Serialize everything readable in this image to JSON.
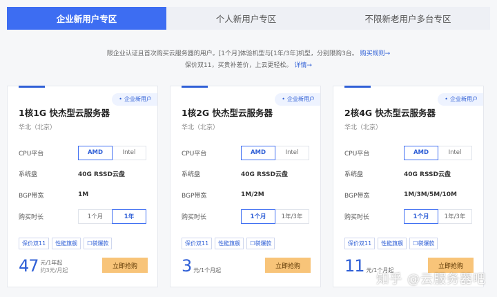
{
  "tabs": [
    {
      "label": "企业新用户专区",
      "active": true
    },
    {
      "label": "个人新用户专区",
      "active": false
    },
    {
      "label": "不限新老用户多台专区",
      "active": false
    }
  ],
  "intro": {
    "line1": "限企业认证且首次购买云服务器的用户。[1个月]体验机型与[1年/3年]机型，分别限购3台。",
    "line1_link": "购买规则",
    "line2": "保价双11，买贵补差价，上云更轻松。",
    "line2_link": "详情"
  },
  "cards": [
    {
      "badge": "企业新用户",
      "title": "1核1G 快杰型云服务器",
      "region": "华北（北京）",
      "cpu_label": "CPU平台",
      "cpu_options": [
        "AMD",
        "Intel"
      ],
      "disk_label": "系统盘",
      "disk_value": "40G RSSD云盘",
      "bw_label": "BGP带宽",
      "bw_value": "1M",
      "dur_label": "购买时长",
      "dur_options": [
        "1个月",
        "1年"
      ],
      "tags": [
        "保价双11",
        "性能旗舰",
        "☐袋爆款"
      ],
      "price_num": "47",
      "price_unit": "元/1年起",
      "price_sub": "约3元/月起",
      "buy_label": "立即抢购"
    },
    {
      "badge": "企业新用户",
      "title": "1核2G 快杰型云服务器",
      "region": "华北（北京）",
      "cpu_label": "CPU平台",
      "cpu_options": [
        "AMD",
        "Intel"
      ],
      "disk_label": "系统盘",
      "disk_value": "40G RSSD云盘",
      "bw_label": "BGP带宽",
      "bw_value": "1M/2M",
      "dur_label": "购买时长",
      "dur_options": [
        "1个月",
        "1年/3年"
      ],
      "tags": [
        "保价双11",
        "性能旗舰",
        "☐袋爆款"
      ],
      "price_num": "3",
      "price_unit": "元/1个月起",
      "price_sub": "",
      "buy_label": "立即抢购"
    },
    {
      "badge": "企业新用户",
      "title": "2核4G 快杰型云服务器",
      "region": "华北（北京）",
      "cpu_label": "CPU平台",
      "cpu_options": [
        "AMD",
        "Intel"
      ],
      "disk_label": "系统盘",
      "disk_value": "40G RSSD云盘",
      "bw_label": "BGP带宽",
      "bw_value": "1M/3M/5M/10M",
      "dur_label": "购买时长",
      "dur_options": [
        "1个月",
        "1年/3年"
      ],
      "tags": [
        "保价双11",
        "性能旗舰",
        "☐袋爆款"
      ],
      "price_num": "11",
      "price_unit": "元/1个月起",
      "price_sub": "",
      "buy_label": "立即抢购"
    }
  ],
  "watermark": "知乎 @云服务器吧"
}
